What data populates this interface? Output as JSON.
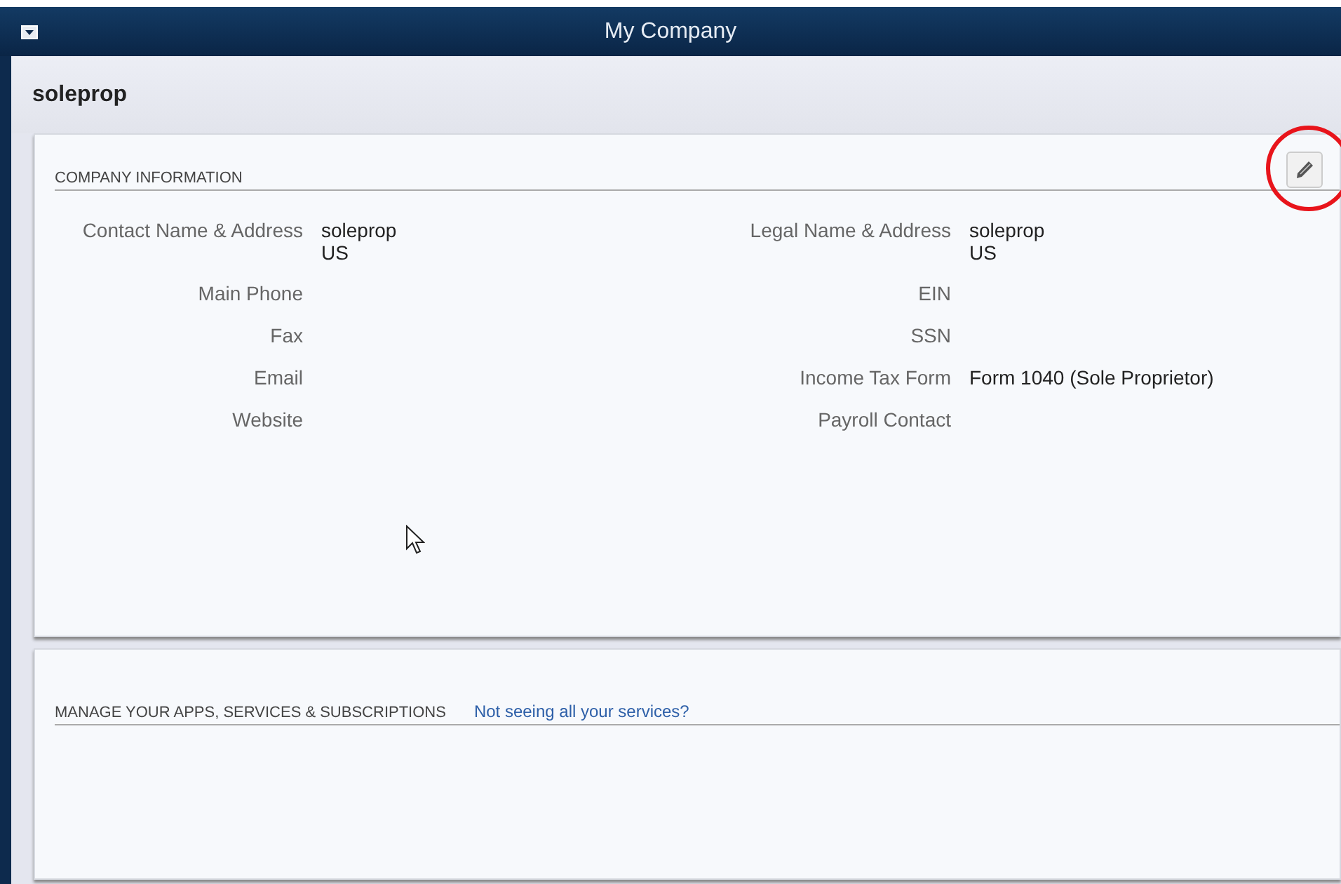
{
  "window": {
    "title": "My Company"
  },
  "company_name": "soleprop",
  "company_information": {
    "heading": "COMPANY INFORMATION",
    "left_fields": [
      {
        "label": "Contact Name & Address",
        "value": [
          "soleprop",
          "US"
        ]
      },
      {
        "label": "Main Phone"
      },
      {
        "label": "Fax"
      },
      {
        "label": "Email"
      },
      {
        "label": "Website"
      }
    ],
    "right_fields": [
      {
        "label": "Legal Name & Address",
        "value": [
          "soleprop",
          "US"
        ]
      },
      {
        "label": "EIN"
      },
      {
        "label": "SSN"
      },
      {
        "label": "Income Tax Form",
        "value": [
          "Form 1040 (Sole Proprietor)"
        ]
      },
      {
        "label": "Payroll Contact"
      }
    ]
  },
  "apps_section": {
    "heading": "MANAGE YOUR APPS, SERVICES & SUBSCRIPTIONS",
    "link": "Not seeing all your services?"
  }
}
